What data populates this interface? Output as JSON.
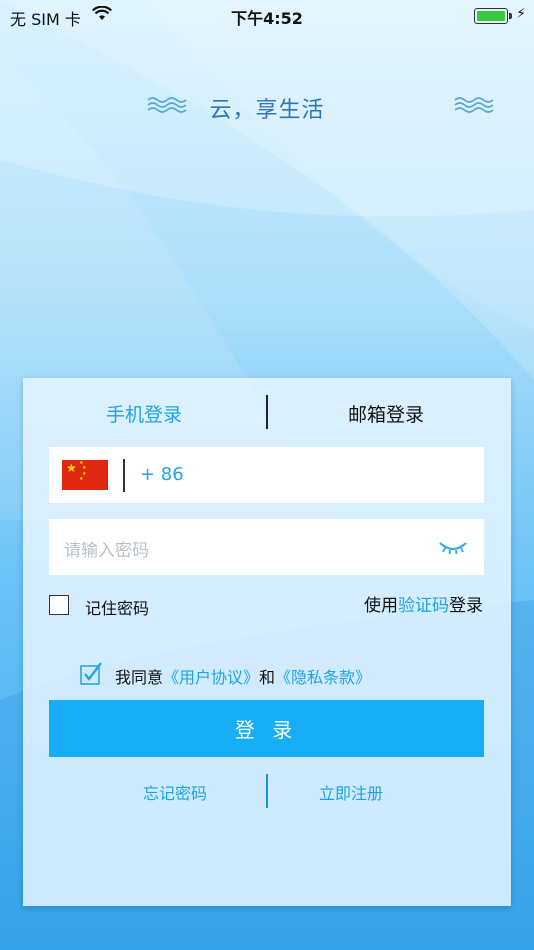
{
  "status_bar": {
    "carrier": "无 SIM 卡",
    "time": "下午4:52"
  },
  "slogan": "云，享生活",
  "tabs": {
    "phone_login": "手机登录",
    "email_login": "邮箱登录"
  },
  "phone_field": {
    "country_code": "+ 86"
  },
  "password_field": {
    "placeholder": "请输入密码"
  },
  "remember": {
    "label": "记住密码",
    "checked": false
  },
  "code_login": {
    "prefix": "使用",
    "link": "验证码",
    "suffix": "登录"
  },
  "agreement": {
    "checked": true,
    "prefix": "我同意",
    "user_agreement": "《用户协议》",
    "and": "和",
    "privacy_policy": "《隐私条款》"
  },
  "login_button": "登 录",
  "links": {
    "forgot_password": "忘记密码",
    "register": "立即注册"
  },
  "colors": {
    "accent": "#1ea3e8",
    "button": "#18aef5",
    "flag_red": "#de2910",
    "flag_star": "#ffde00"
  },
  "icons": {
    "wifi": "wifi-icon",
    "battery": "battery-icon",
    "charging": "bolt-icon",
    "flag": "china-flag-icon",
    "eye": "eye-closed-icon",
    "wave": "wave-icon",
    "check": "checkmark-icon"
  }
}
